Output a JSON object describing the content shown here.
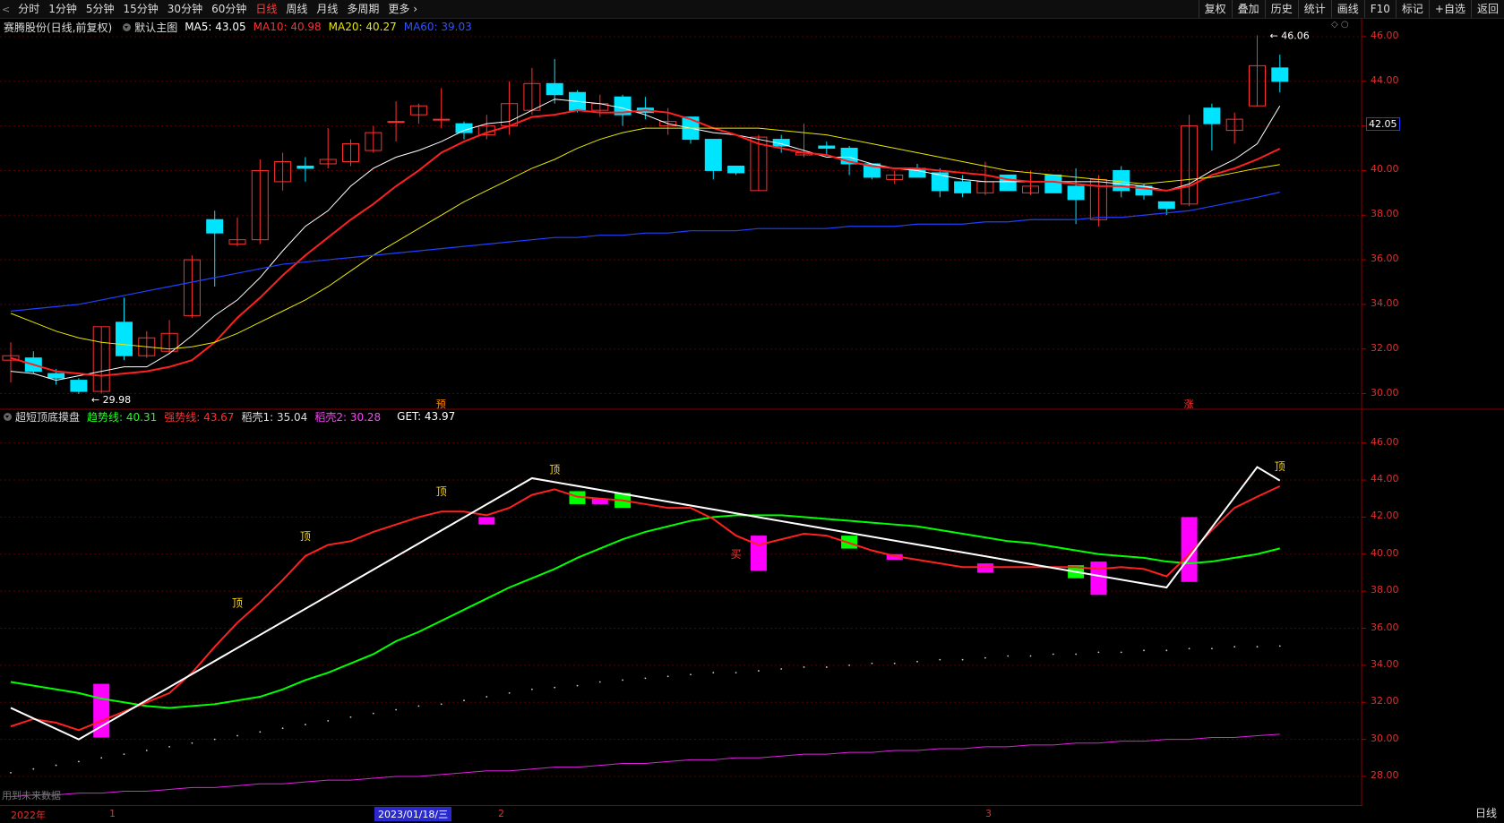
{
  "toolbar": {
    "back_icon": "chevron-left-icon",
    "periods": [
      "分时",
      "1分钟",
      "5分钟",
      "15分钟",
      "30分钟",
      "60分钟",
      "日线",
      "周线",
      "月线",
      "多周期",
      "更多"
    ],
    "active_period": "日线",
    "right_buttons": [
      "复权",
      "叠加",
      "历史",
      "统计",
      "画线",
      "F10",
      "标记",
      "+自选",
      "返回"
    ]
  },
  "main_legend": {
    "stock": "赛腾股份(日线,前复权)",
    "template": "默认主图",
    "ma5": "MA5: 43.05",
    "ma10": "MA10: 40.98",
    "ma20": "MA20: 40.27",
    "ma60": "MA60: 39.03",
    "colors": {
      "ma5": "#ffffff",
      "ma10": "#ff2020",
      "ma20": "#e8e800",
      "ma60": "#2040ff"
    }
  },
  "sub_legend": {
    "name": "超短顶底摸盘",
    "trend": "趋势线: 40.31",
    "strong": "强势线: 43.67",
    "chaff1": "稻壳1: 35.04",
    "chaff2": "稻壳2: 30.28",
    "get": "GET: 43.97"
  },
  "price_axis_main": [
    "46.00",
    "44.00",
    "42.00",
    "40.00",
    "38.00",
    "36.00",
    "34.00",
    "32.00",
    "30.00"
  ],
  "price_axis_sub": [
    "46.00",
    "44.00",
    "42.00",
    "40.00",
    "38.00",
    "36.00",
    "34.00",
    "32.00",
    "30.00",
    "28.00"
  ],
  "current_price": "42.05",
  "max_label": "46.06",
  "min_label": "29.98",
  "markers": {
    "pre": "预",
    "zhang": "涨",
    "top": "顶",
    "buy": "买"
  },
  "date_axis": {
    "year": "2022年",
    "m1": "1",
    "cursor": "2023/01/18/三",
    "m2": "2",
    "m3": "3"
  },
  "period_label": "日线",
  "footnote": "用到未来数据",
  "chart_data": [
    {
      "type": "candlestick",
      "title": "赛腾股份(日线,前复权)",
      "ylim": [
        29.5,
        46.2
      ],
      "candles": [
        [
          31.5,
          32.3,
          30.5,
          31.7
        ],
        [
          31.6,
          31.9,
          30.9,
          31.0
        ],
        [
          30.9,
          31.1,
          30.4,
          30.7
        ],
        [
          30.6,
          30.7,
          29.98,
          30.1
        ],
        [
          30.1,
          33.0,
          30.0,
          33.0
        ],
        [
          33.2,
          34.3,
          31.5,
          31.7
        ],
        [
          31.7,
          32.8,
          31.6,
          32.5
        ],
        [
          31.9,
          33.3,
          31.8,
          32.7
        ],
        [
          33.5,
          36.2,
          33.4,
          36.0
        ],
        [
          37.8,
          38.2,
          34.8,
          37.2
        ],
        [
          36.7,
          37.9,
          36.6,
          36.9
        ],
        [
          36.9,
          40.5,
          36.7,
          40.0
        ],
        [
          39.5,
          40.8,
          39.1,
          40.4
        ],
        [
          40.2,
          40.6,
          39.5,
          40.1
        ],
        [
          40.3,
          41.9,
          40.1,
          40.5
        ],
        [
          40.4,
          41.4,
          40.2,
          41.2
        ],
        [
          40.9,
          42.0,
          40.8,
          41.7
        ],
        [
          42.2,
          43.1,
          41.3,
          42.2
        ],
        [
          42.5,
          43.0,
          42.1,
          42.9
        ],
        [
          42.3,
          43.7,
          41.9,
          42.3
        ],
        [
          42.1,
          42.2,
          41.4,
          41.7
        ],
        [
          41.6,
          42.5,
          41.4,
          42.0
        ],
        [
          42.0,
          44.0,
          41.6,
          43.0
        ],
        [
          42.7,
          44.6,
          42.5,
          43.9
        ],
        [
          43.9,
          45.0,
          43.0,
          43.4
        ],
        [
          43.5,
          43.6,
          42.6,
          42.7
        ],
        [
          42.7,
          43.4,
          42.4,
          43.0
        ],
        [
          43.3,
          43.4,
          42.0,
          42.5
        ],
        [
          42.8,
          43.3,
          42.3,
          42.6
        ],
        [
          42.0,
          42.8,
          41.6,
          42.2
        ],
        [
          42.4,
          42.4,
          41.2,
          41.4
        ],
        [
          41.4,
          41.4,
          39.6,
          40.0
        ],
        [
          40.2,
          40.2,
          39.8,
          39.9
        ],
        [
          39.1,
          41.6,
          39.1,
          41.5
        ],
        [
          41.4,
          41.6,
          40.8,
          41.1
        ],
        [
          40.7,
          42.1,
          40.6,
          40.8
        ],
        [
          41.1,
          41.3,
          40.7,
          41.0
        ],
        [
          41.0,
          41.1,
          39.8,
          40.3
        ],
        [
          40.3,
          40.3,
          39.6,
          39.7
        ],
        [
          39.6,
          40.0,
          39.4,
          39.8
        ],
        [
          40.1,
          40.3,
          39.7,
          39.7
        ],
        [
          39.9,
          40.1,
          38.8,
          39.1
        ],
        [
          39.5,
          39.8,
          38.8,
          39.0
        ],
        [
          39.0,
          40.4,
          38.9,
          39.5
        ],
        [
          39.8,
          39.8,
          39.1,
          39.1
        ],
        [
          39.0,
          40.0,
          38.9,
          39.3
        ],
        [
          39.8,
          39.8,
          39.0,
          39.0
        ],
        [
          39.3,
          40.1,
          37.6,
          38.7
        ],
        [
          37.8,
          39.8,
          37.5,
          39.6
        ],
        [
          40.0,
          40.2,
          38.8,
          39.1
        ],
        [
          39.3,
          39.4,
          38.7,
          38.9
        ],
        [
          38.6,
          38.6,
          38.0,
          38.3
        ],
        [
          38.5,
          42.5,
          38.4,
          42.0
        ],
        [
          42.8,
          43.0,
          40.9,
          42.1
        ],
        [
          41.8,
          42.6,
          41.2,
          42.3
        ],
        [
          42.9,
          46.06,
          42.9,
          44.7
        ],
        [
          44.6,
          45.2,
          43.5,
          44.0
        ]
      ],
      "ma": {
        "MA5": [
          31.0,
          30.9,
          30.6,
          30.8,
          31.0,
          31.2,
          31.2,
          31.8,
          32.6,
          33.5,
          34.2,
          35.2,
          36.4,
          37.5,
          38.2,
          39.3,
          40.1,
          40.6,
          40.9,
          41.3,
          41.8,
          42.1,
          42.2,
          42.7,
          43.2,
          43.1,
          43.0,
          42.8,
          42.5,
          42.1,
          41.9,
          41.7,
          41.6,
          41.4,
          41.2,
          40.9,
          40.6,
          40.6,
          40.3,
          40.1,
          40.0,
          39.8,
          39.6,
          39.5,
          39.5,
          39.5,
          39.5,
          39.5,
          39.5,
          39.4,
          39.3,
          39.1,
          39.4,
          40.0,
          40.5,
          41.2,
          42.9
        ],
        "MA10": [
          31.6,
          31.3,
          31.0,
          30.9,
          30.8,
          30.9,
          31.0,
          31.2,
          31.5,
          32.3,
          33.4,
          34.3,
          35.3,
          36.2,
          37.0,
          37.8,
          38.5,
          39.3,
          40.0,
          40.8,
          41.3,
          41.7,
          42.0,
          42.4,
          42.5,
          42.7,
          42.6,
          42.6,
          42.7,
          42.6,
          42.3,
          41.9,
          41.6,
          41.2,
          41.0,
          40.8,
          40.7,
          40.4,
          40.2,
          40.1,
          40.1,
          40.0,
          39.9,
          39.8,
          39.6,
          39.5,
          39.5,
          39.4,
          39.3,
          39.3,
          39.2,
          39.1,
          39.3,
          39.8,
          40.1,
          40.5,
          40.98
        ],
        "MA20": [
          33.6,
          33.2,
          32.8,
          32.5,
          32.3,
          32.2,
          32.1,
          32.0,
          32.1,
          32.3,
          32.7,
          33.2,
          33.7,
          34.2,
          34.8,
          35.5,
          36.2,
          36.8,
          37.4,
          38.0,
          38.6,
          39.1,
          39.6,
          40.1,
          40.5,
          41.0,
          41.4,
          41.7,
          41.9,
          41.9,
          41.9,
          41.9,
          41.9,
          41.9,
          41.8,
          41.7,
          41.6,
          41.4,
          41.2,
          41.0,
          40.8,
          40.6,
          40.4,
          40.2,
          40.0,
          39.9,
          39.8,
          39.7,
          39.6,
          39.5,
          39.4,
          39.5,
          39.6,
          39.7,
          39.9,
          40.1,
          40.27
        ],
        "MA60": [
          33.7,
          33.8,
          33.9,
          34.0,
          34.2,
          34.4,
          34.6,
          34.8,
          35.0,
          35.2,
          35.4,
          35.6,
          35.8,
          35.9,
          36.0,
          36.1,
          36.2,
          36.3,
          36.4,
          36.5,
          36.6,
          36.7,
          36.8,
          36.9,
          37.0,
          37.0,
          37.1,
          37.1,
          37.2,
          37.2,
          37.3,
          37.3,
          37.3,
          37.4,
          37.4,
          37.4,
          37.4,
          37.5,
          37.5,
          37.5,
          37.6,
          37.6,
          37.6,
          37.7,
          37.7,
          37.8,
          37.8,
          37.8,
          37.9,
          37.9,
          38.0,
          38.1,
          38.2,
          38.4,
          38.6,
          38.8,
          39.03
        ]
      },
      "annotations": [
        {
          "index": 3,
          "label": "29.98"
        },
        {
          "index": 55,
          "label": "46.06"
        }
      ]
    },
    {
      "type": "line",
      "title": "超短顶底摸盘",
      "ylim": [
        26.5,
        47.0
      ],
      "series": [
        {
          "name": "趋势线",
          "color": "#00ff00",
          "values": [
            33.1,
            32.9,
            32.7,
            32.5,
            32.2,
            32.0,
            31.8,
            31.7,
            31.8,
            31.9,
            32.1,
            32.3,
            32.7,
            33.2,
            33.6,
            34.1,
            34.6,
            35.3,
            35.8,
            36.4,
            37.0,
            37.6,
            38.2,
            38.7,
            39.2,
            39.8,
            40.3,
            40.8,
            41.2,
            41.5,
            41.8,
            42.0,
            42.1,
            42.1,
            42.1,
            42.0,
            41.9,
            41.8,
            41.7,
            41.6,
            41.5,
            41.3,
            41.1,
            40.9,
            40.7,
            40.6,
            40.4,
            40.2,
            40.0,
            39.9,
            39.8,
            39.6,
            39.5,
            39.6,
            39.8,
            40.0,
            40.31
          ]
        },
        {
          "name": "强势线",
          "color": "#ff2020",
          "values": [
            30.7,
            31.1,
            30.9,
            30.5,
            31.0,
            31.5,
            32.0,
            32.5,
            33.6,
            35.0,
            36.3,
            37.4,
            38.6,
            39.9,
            40.5,
            40.7,
            41.2,
            41.6,
            42.0,
            42.3,
            42.3,
            42.1,
            42.5,
            43.2,
            43.5,
            43.1,
            43.0,
            42.9,
            42.7,
            42.5,
            42.5,
            41.9,
            41.0,
            40.5,
            40.8,
            41.1,
            41.0,
            40.6,
            40.2,
            39.9,
            39.7,
            39.5,
            39.3,
            39.3,
            39.3,
            39.3,
            39.3,
            39.3,
            39.2,
            39.3,
            39.2,
            38.8,
            40.0,
            41.3,
            42.5,
            43.1,
            43.67
          ]
        },
        {
          "name": "GET",
          "color": "#ffffff",
          "points": [
            [
              0,
              31.7
            ],
            [
              3,
              30.0
            ],
            [
              23,
              44.1
            ],
            [
              51,
              38.2
            ],
            [
              55,
              44.7
            ],
            [
              56,
              43.97
            ]
          ]
        },
        {
          "name": "稻壳1",
          "color": "#cccccc",
          "style": "dotted",
          "values": [
            28.2,
            28.4,
            28.6,
            28.8,
            29.0,
            29.2,
            29.4,
            29.6,
            29.8,
            30.0,
            30.2,
            30.4,
            30.6,
            30.8,
            31.0,
            31.2,
            31.4,
            31.6,
            31.8,
            31.9,
            32.1,
            32.3,
            32.5,
            32.7,
            32.8,
            32.9,
            33.1,
            33.2,
            33.3,
            33.4,
            33.5,
            33.6,
            33.6,
            33.7,
            33.8,
            33.9,
            33.9,
            34.0,
            34.1,
            34.1,
            34.2,
            34.3,
            34.3,
            34.4,
            34.5,
            34.5,
            34.6,
            34.6,
            34.7,
            34.7,
            34.8,
            34.8,
            34.9,
            34.9,
            35.0,
            35.0,
            35.04
          ]
        },
        {
          "name": "稻壳2",
          "color": "#e020e0",
          "values": [
            26.9,
            27.0,
            27.0,
            27.1,
            27.1,
            27.2,
            27.2,
            27.3,
            27.4,
            27.4,
            27.5,
            27.6,
            27.6,
            27.7,
            27.8,
            27.8,
            27.9,
            28.0,
            28.0,
            28.1,
            28.2,
            28.3,
            28.3,
            28.4,
            28.5,
            28.5,
            28.6,
            28.7,
            28.7,
            28.8,
            28.9,
            28.9,
            29.0,
            29.0,
            29.1,
            29.2,
            29.2,
            29.3,
            29.3,
            29.4,
            29.4,
            29.5,
            29.5,
            29.6,
            29.6,
            29.7,
            29.7,
            29.8,
            29.8,
            29.9,
            29.9,
            30.0,
            30.0,
            30.1,
            30.1,
            30.2,
            30.28
          ]
        }
      ],
      "bars": [
        {
          "index": 4,
          "top": 33.0,
          "bottom": 30.1,
          "color": "#ff00ff"
        },
        {
          "index": 21,
          "top": 42.0,
          "bottom": 41.6,
          "color": "#ff00ff"
        },
        {
          "index": 25,
          "top": 43.4,
          "bottom": 42.7,
          "color": "#00ff00"
        },
        {
          "index": 26,
          "top": 43.0,
          "bottom": 42.7,
          "color": "#ff00ff"
        },
        {
          "index": 27,
          "top": 43.3,
          "bottom": 42.5,
          "color": "#00ff00"
        },
        {
          "index": 33,
          "top": 41.0,
          "bottom": 39.1,
          "color": "#ff00ff"
        },
        {
          "index": 37,
          "top": 41.0,
          "bottom": 40.3,
          "color": "#00ff00"
        },
        {
          "index": 39,
          "top": 40.0,
          "bottom": 39.7,
          "color": "#ff00ff"
        },
        {
          "index": 43,
          "top": 39.5,
          "bottom": 39.0,
          "color": "#ff00ff"
        },
        {
          "index": 47,
          "top": 39.4,
          "bottom": 38.7,
          "color": "#00ff00"
        },
        {
          "index": 48,
          "top": 39.6,
          "bottom": 37.8,
          "color": "#ff00ff"
        },
        {
          "index": 52,
          "top": 42.0,
          "bottom": 38.5,
          "color": "#ff00ff"
        }
      ],
      "top_markers": [
        10,
        13,
        19,
        24,
        56
      ],
      "buy_markers": [
        32
      ]
    }
  ]
}
